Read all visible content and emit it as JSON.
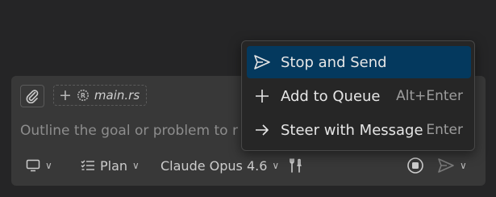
{
  "composer": {
    "attachment_context": {
      "filename": "main.rs"
    },
    "input": {
      "placeholder": "Outline the goal or problem to r"
    },
    "toolbar": {
      "mode": {
        "label": "Plan"
      },
      "model": {
        "label": "Claude Opus 4.6"
      }
    }
  },
  "send_menu": {
    "items": [
      {
        "label": "Stop and Send",
        "shortcut": "",
        "icon": "send-icon",
        "active": true
      },
      {
        "label": "Add to Queue",
        "shortcut": "Alt+Enter",
        "icon": "plus-icon",
        "active": false
      },
      {
        "label": "Steer with Message",
        "shortcut": "Enter",
        "icon": "arrow-right-icon",
        "active": false
      }
    ]
  },
  "colors": {
    "background": "#252526",
    "composer": "#383838",
    "menu_background": "#262626",
    "menu_highlight": "#04395e"
  }
}
